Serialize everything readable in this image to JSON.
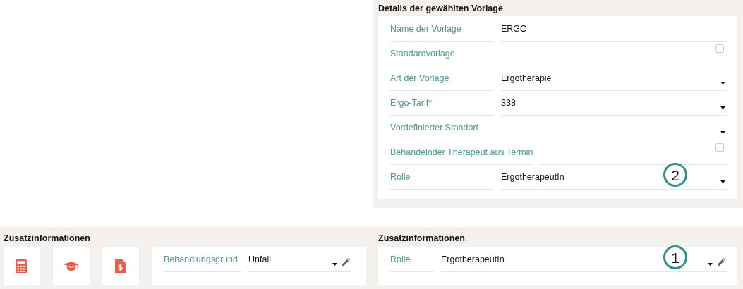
{
  "details": {
    "title": "Details der gewählten Vorlage",
    "fields": [
      {
        "kind": "text",
        "label": "Name der Vorlage",
        "value": "ERGO"
      },
      {
        "kind": "checkbox",
        "label": "Standardvorlage",
        "checked": false
      },
      {
        "kind": "select",
        "label": "Art der Vorlage",
        "value": "Ergotherapie"
      },
      {
        "kind": "select",
        "label": "Ergo-Tarif*",
        "value": "338"
      },
      {
        "kind": "select",
        "label": "Vordefinierter Standort"
      },
      {
        "kind": "checkbox",
        "label": "Behandelnder Therapeut aus Termin",
        "checked": false
      },
      {
        "kind": "select",
        "label": "Rolle",
        "value": "ErgotherapeutIn",
        "callout": "2"
      }
    ]
  },
  "left_info": {
    "title": "Zusatzinformationen",
    "tiles": [
      {
        "kind": "calculator"
      },
      {
        "kind": "graduation"
      },
      {
        "kind": "invoice"
      }
    ],
    "field": {
      "label": "Behandlungsgrund",
      "value": "Unfall"
    }
  },
  "right_info": {
    "title": "Zusatzinformationen",
    "field": {
      "label": "Rolle",
      "value": "ErgotherapeutIn",
      "callout": "1"
    }
  }
}
